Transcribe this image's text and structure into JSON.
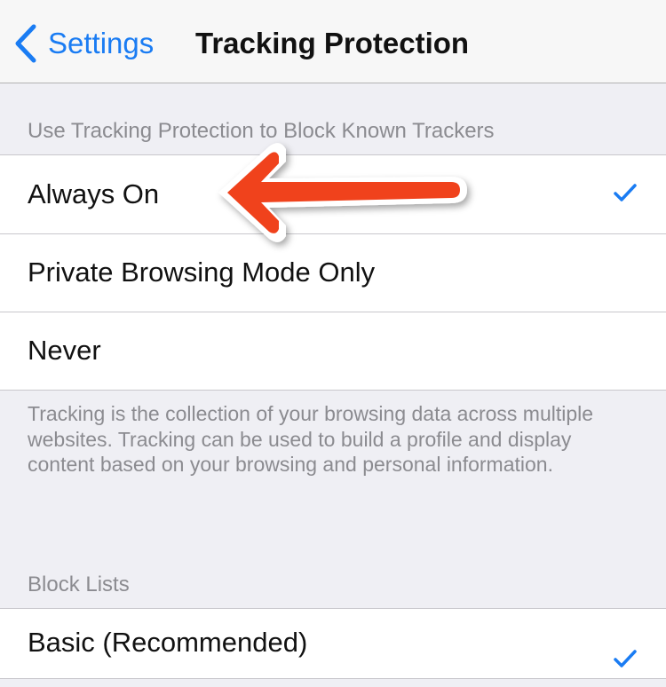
{
  "navbar": {
    "back_label": "Settings",
    "title": "Tracking Protection"
  },
  "tracking_section": {
    "header": "Use Tracking Protection to Block Known Trackers",
    "options": [
      {
        "label": "Always On",
        "selected": true
      },
      {
        "label": "Private Browsing Mode Only",
        "selected": false
      },
      {
        "label": "Never",
        "selected": false
      }
    ],
    "footer": "Tracking is the collection of your browsing data across multiple websites. Tracking can be used to build a profile and display content based on your browsing and personal information."
  },
  "block_lists_section": {
    "header": "Block Lists",
    "options": [
      {
        "label": "Basic (Recommended)",
        "selected": true
      }
    ]
  },
  "colors": {
    "accent": "#1a7cf3",
    "annotation_arrow": "#f0431c",
    "background": "#efeff4"
  },
  "icons": {
    "back": "chevron-left-icon",
    "selected": "checkmark-icon",
    "annotation": "arrow-left-icon"
  }
}
